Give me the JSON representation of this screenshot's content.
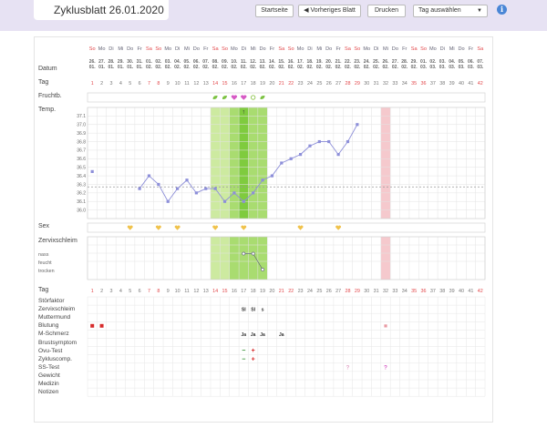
{
  "header": {
    "title": "Zyklusblatt 26.01.2020",
    "btn_start": "Startseite",
    "btn_prev": "◀ Vorheriges Blatt",
    "btn_print": "Drucken",
    "select_day": "Tag auswählen",
    "info": "i"
  },
  "labels": {
    "datum": "Datum",
    "tag": "Tag",
    "frucht": "Fruchtb.",
    "temp": "Temp.",
    "sex": "Sex",
    "zervix": "Zervixschleim",
    "nass": "nass",
    "feucht": "feucht",
    "trocken": "trocken",
    "tag2": "Tag",
    "rows": [
      "Störfaktor",
      "Zervixschleim",
      "Muttermund",
      "Blutung",
      "M-Schmerz",
      "Brustsymptom",
      "Ovu-Test",
      "Zykluscomp.",
      "SS-Test",
      "Gewicht",
      "Medizin",
      "Notizen"
    ]
  },
  "weekdays": [
    "So",
    "Mo",
    "Di",
    "Mi",
    "Do",
    "Fr",
    "Sa",
    "So",
    "Mo",
    "Di",
    "Mi",
    "Do",
    "Fr",
    "Sa",
    "So",
    "Mo",
    "Di",
    "Mi",
    "Do",
    "Fr",
    "Sa",
    "So",
    "Mo",
    "Di",
    "Mi",
    "Do",
    "Fr",
    "Sa",
    "So",
    "Mo",
    "Di",
    "Mi",
    "Do",
    "Fr",
    "Sa",
    "So",
    "Mo",
    "Di",
    "Mi",
    "Do",
    "Fr",
    "Sa"
  ],
  "dates_day": [
    "26.",
    "27.",
    "28.",
    "29.",
    "30.",
    "31.",
    "01.",
    "02.",
    "03.",
    "04.",
    "05.",
    "06.",
    "07.",
    "08.",
    "09.",
    "10.",
    "11.",
    "12.",
    "13.",
    "14.",
    "15.",
    "16.",
    "17.",
    "18.",
    "19.",
    "20.",
    "21.",
    "22.",
    "23.",
    "24.",
    "25.",
    "26.",
    "27.",
    "28.",
    "29.",
    "01.",
    "02.",
    "03.",
    "04.",
    "05.",
    "06.",
    "07."
  ],
  "dates_month": [
    "01.",
    "01.",
    "01.",
    "01.",
    "01.",
    "01.",
    "02.",
    "02.",
    "02.",
    "02.",
    "02.",
    "02.",
    "02.",
    "02.",
    "02.",
    "02.",
    "02.",
    "02.",
    "02.",
    "02.",
    "02.",
    "02.",
    "02.",
    "02.",
    "02.",
    "02.",
    "02.",
    "02.",
    "02.",
    "02.",
    "02.",
    "02.",
    "02.",
    "02.",
    "02.",
    "03.",
    "03.",
    "03.",
    "03.",
    "03.",
    "03.",
    "03."
  ],
  "temp_axis": [
    "37.1",
    "37.0",
    "36.9",
    "36.8",
    "36.7",
    "36.6",
    "36.5",
    "36.4",
    "36.3",
    "36.2",
    "36.1",
    "36.0"
  ],
  "temp_values": [
    36.45,
    null,
    null,
    null,
    null,
    36.25,
    36.4,
    36.3,
    36.1,
    36.25,
    36.35,
    36.2,
    36.25,
    36.25,
    36.1,
    36.2,
    36.1,
    36.2,
    36.35,
    36.4,
    36.55,
    36.6,
    36.65,
    36.75,
    36.8,
    36.8,
    36.65,
    36.8,
    37.0
  ],
  "coverline": 36.27,
  "zervix_marks": [
    {
      "day": 17,
      "level": 0,
      "text": "Sl"
    },
    {
      "day": 18,
      "level": 0,
      "text": "Sl"
    },
    {
      "day": 19,
      "level": 2,
      "text": "s"
    }
  ],
  "sex_days": [
    5,
    8,
    10,
    14,
    17,
    23,
    27
  ],
  "fruchtb": [
    {
      "day": 14,
      "sym": "leaf"
    },
    {
      "day": 15,
      "sym": "leaf"
    },
    {
      "day": 16,
      "sym": "heart"
    },
    {
      "day": 17,
      "sym": "heart"
    },
    {
      "day": 18,
      "sym": "ring"
    },
    {
      "day": 19,
      "sym": "leaf"
    }
  ],
  "blutung_days": [
    1,
    2,
    32
  ],
  "mschmerz": [
    {
      "day": 17,
      "text": "Ja"
    },
    {
      "day": 18,
      "text": "Ja"
    },
    {
      "day": 19,
      "text": "Ja"
    },
    {
      "day": 21,
      "text": "Ja"
    }
  ],
  "ovu": [
    {
      "day": 17,
      "text": "−"
    },
    {
      "day": 18,
      "text": "+"
    }
  ],
  "zykluscomp": [
    {
      "day": 17,
      "text": "−"
    },
    {
      "day": 18,
      "text": "+"
    }
  ],
  "sstest": [
    {
      "day": 28,
      "text": "?"
    },
    {
      "day": 32,
      "text": "?"
    }
  ],
  "colors": {
    "accent": "#e7e2f3",
    "fertile": "#cdeaa0",
    "ovulation": "#7fcb3e",
    "curve": "#8d8fd9",
    "weekend": "#e2474a",
    "pink": "#f5c9cd"
  }
}
